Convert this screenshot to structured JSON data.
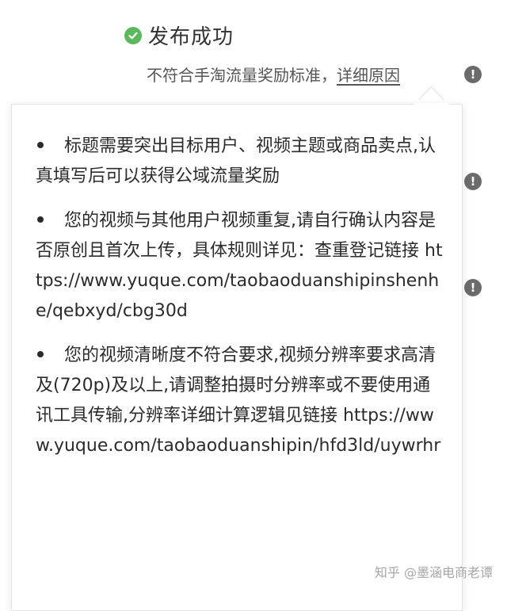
{
  "status": {
    "title": "发布成功",
    "icon": "check-circle-icon",
    "color": "#5cb85c"
  },
  "notice": {
    "text": "不符合手淘流量奖励标准，",
    "link_label": "详细原因",
    "icon": "alert-circle-icon"
  },
  "reasons": [
    {
      "text": "标题需要突出目标用户、视频主题或商品卖点,认真填写后可以获得公域流量奖励"
    },
    {
      "text": "您的视频与其他用户视频重复,请自行确认内容是否原创且首次上传，具体规则详见：查重登记链接 https://www.yuque.com/taobaoduanshipinshenhe/qebxyd/cbg30d"
    },
    {
      "text": "您的视频清晰度不符合要求,视频分辨率要求高清及(720p)及以上,请调整拍摄时分辨率或不要使用通讯工具传输,分辨率详细计算逻辑见链接 https://www.yuque.com/taobaoduanshipin/hfd3ld/uywrhr"
    }
  ],
  "watermark": "知乎 @墨涵电商老谭"
}
